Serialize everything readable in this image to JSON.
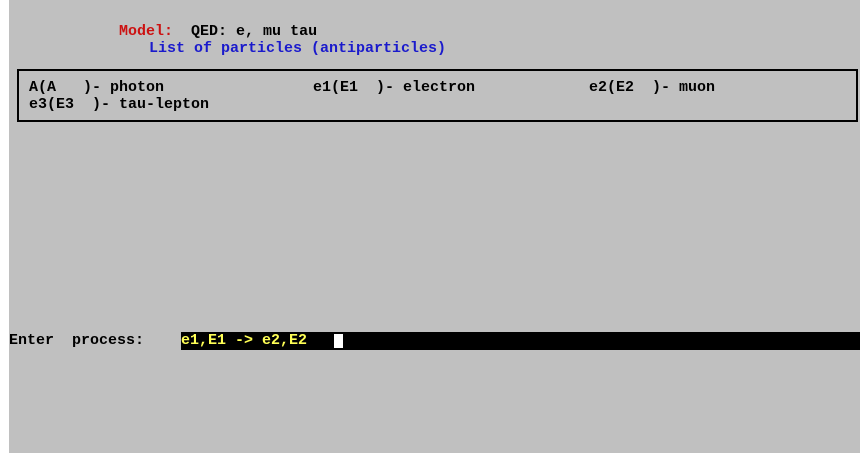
{
  "model": {
    "label": "Model:",
    "value": "QED: e, mu tau"
  },
  "particle_list": {
    "title": "List of particles (antiparticles)",
    "items": [
      "A(A   )- photon",
      "e1(E1  )- electron",
      "e2(E2  )- muon",
      "e3(E3  )- tau-lepton"
    ]
  },
  "prompt": {
    "label": "Enter  process:",
    "input_value": "e1,E1 -> e2,E2"
  },
  "colors": {
    "background": "#c0c0c0",
    "model_label": "#cc1111",
    "list_title": "#1a1acc",
    "input_background": "#000000",
    "input_text": "#ffff55"
  }
}
